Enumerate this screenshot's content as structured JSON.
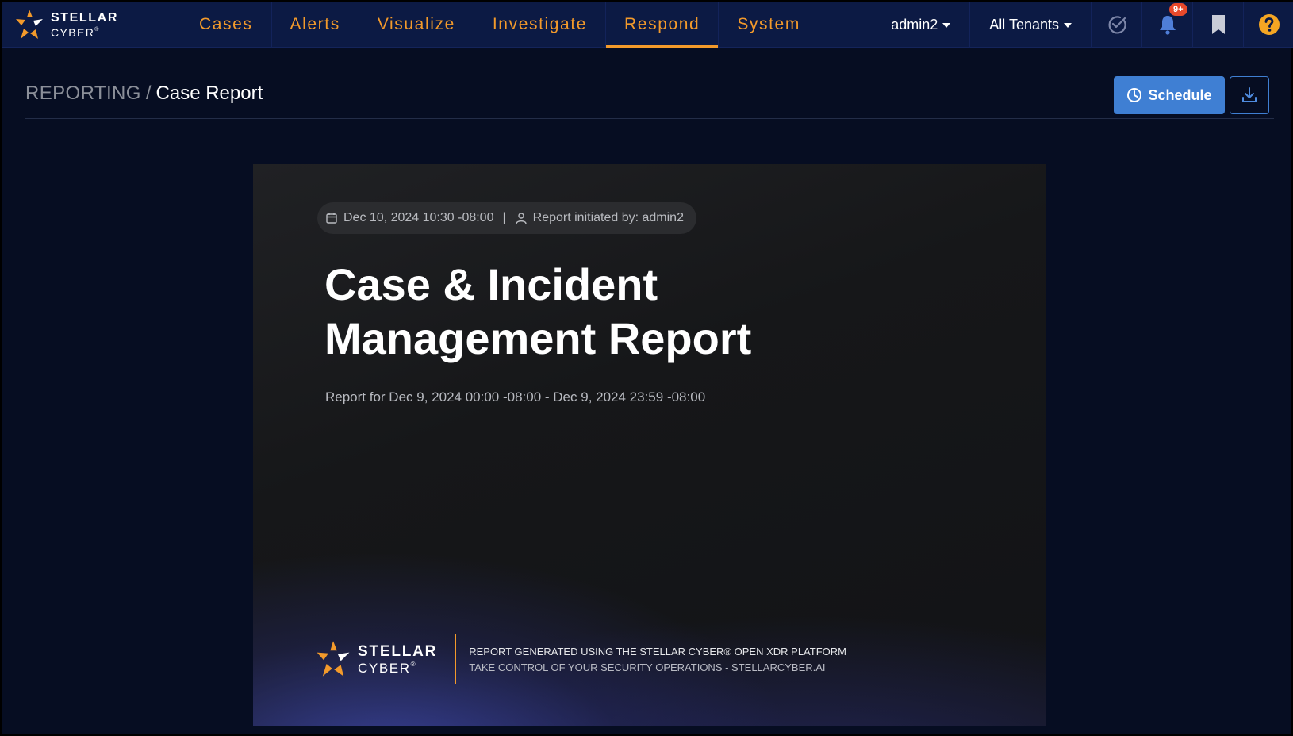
{
  "brand": {
    "line1": "STELLAR",
    "line2": "CYBER",
    "reg": "®",
    "primary_color": "#f39a2b"
  },
  "nav": {
    "tabs": [
      {
        "label": "Cases",
        "active": false
      },
      {
        "label": "Alerts",
        "active": false
      },
      {
        "label": "Visualize",
        "active": false
      },
      {
        "label": "Investigate",
        "active": false
      },
      {
        "label": "Respond",
        "active": true
      },
      {
        "label": "System",
        "active": false
      }
    ],
    "user": "admin2",
    "tenant": "All Tenants",
    "notification_badge": "9+",
    "icons": [
      "check-circle-icon",
      "bell-icon",
      "bookmark-icon",
      "help-icon"
    ]
  },
  "header": {
    "breadcrumb_root": "REPORTING",
    "breadcrumb_sep": "/",
    "breadcrumb_current": "Case Report",
    "schedule_label": "Schedule",
    "accent_color": "#3f7fd3"
  },
  "cover": {
    "date": "Dec 10, 2024 10:30 -08:00",
    "separator": "|",
    "initiated_by": "Report initiated by: admin2",
    "title_line1": "Case & Incident",
    "title_line2": "Management Report",
    "range": "Report for Dec 9, 2024 00:00 -08:00 - Dec 9, 2024 23:59 -08:00",
    "footer_brand_line1": "STELLAR",
    "footer_brand_line2": "CYBER",
    "footer_line1": "REPORT GENERATED USING THE STELLAR CYBER® OPEN XDR PLATFORM",
    "footer_line2": "TAKE CONTROL OF YOUR SECURITY OPERATIONS - STELLARCYBER.AI"
  }
}
